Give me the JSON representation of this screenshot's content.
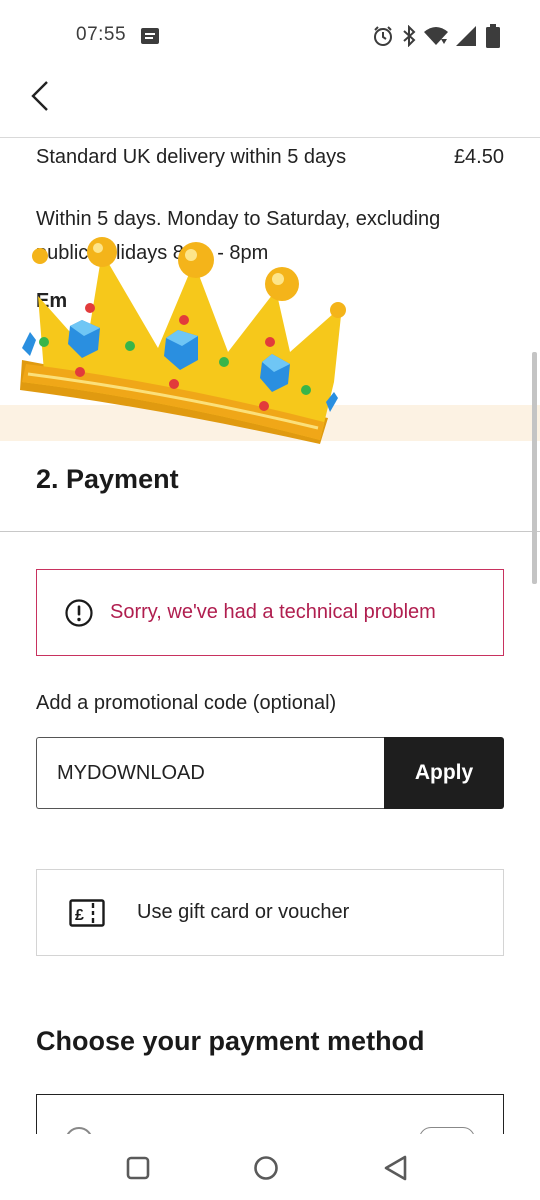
{
  "status_bar": {
    "time": "07:55",
    "icons": [
      "message-icon",
      "alarm-icon",
      "bluetooth-icon",
      "wifi-icon",
      "signal-icon",
      "battery-icon"
    ]
  },
  "header": {
    "back_icon": "chevron-left-icon"
  },
  "delivery": {
    "option_label": "Standard UK delivery within 5 days",
    "option_price": "£4.50",
    "description_line1": "Within 5 days. Monday to Saturday, excluding",
    "description_line2": "public holidays 8am - 8pm",
    "next_label_partial": "Em"
  },
  "overlay": {
    "image": "crown-sticker"
  },
  "payment": {
    "heading": "2. Payment",
    "error_message": "Sorry, we've had a technical problem",
    "error_icon": "exclamation-circle-icon",
    "promo_label": "Add a promotional code (optional)",
    "promo_value": "MYDOWNLOAD",
    "apply_label": "Apply",
    "gift_card_label": "Use gift card or voucher",
    "gift_card_icon": "gift-card-icon",
    "method_heading": "Choose your payment method"
  },
  "colors": {
    "error": "#b01e4f",
    "error_border": "#c8325f",
    "apply_bg": "#1e1e1e",
    "cream_band": "#fcf2e3",
    "crown_gold": "#f5c518"
  },
  "nav": {
    "icons": [
      "recents-square-icon",
      "home-circle-icon",
      "back-triangle-icon"
    ]
  }
}
